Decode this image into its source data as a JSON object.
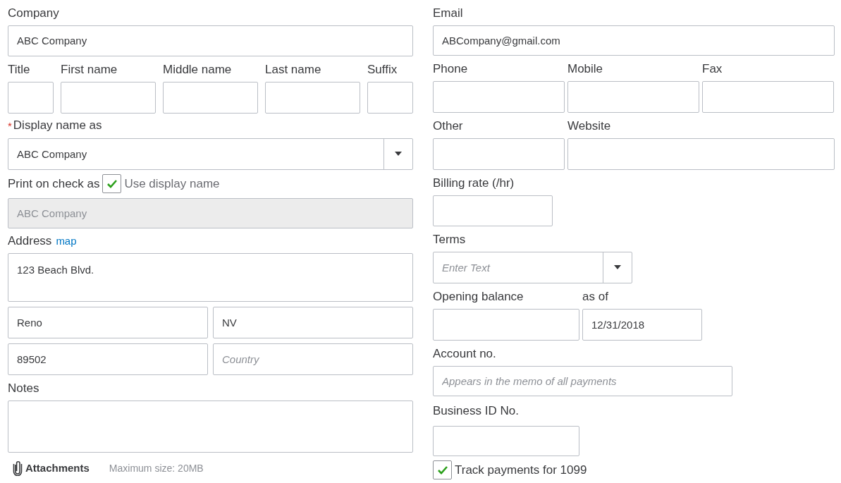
{
  "left": {
    "company": {
      "label": "Company",
      "value": "ABC Company"
    },
    "name_fields": [
      {
        "label": "Title"
      },
      {
        "label": "First name"
      },
      {
        "label": "Middle name"
      },
      {
        "label": "Last name"
      },
      {
        "label": "Suffix"
      }
    ],
    "display_name": {
      "label": "Display name as",
      "required_mark": "*",
      "value": "ABC Company"
    },
    "print_on_check": {
      "label": "Print on check as",
      "checkbox_label": "Use display name",
      "checked": true,
      "value": "ABC Company",
      "disabled": true
    },
    "address": {
      "label": "Address",
      "link": "map",
      "street": "123 Beach Blvd.",
      "city": "Reno",
      "state": "NV",
      "zip": "89502",
      "country_placeholder": "Country"
    },
    "notes": {
      "label": "Notes"
    },
    "attachments": {
      "label": "Attachments",
      "note": "Maximum size: 20MB"
    }
  },
  "right": {
    "email": {
      "label": "Email",
      "value": "ABCompany@gmail.com"
    },
    "phone_fields": [
      {
        "label": "Phone"
      },
      {
        "label": "Mobile"
      },
      {
        "label": "Fax"
      }
    ],
    "other_fields": [
      {
        "label": "Other"
      },
      {
        "label": "Website"
      }
    ],
    "billing_rate": {
      "label": "Billing rate (/hr)"
    },
    "terms": {
      "label": "Terms",
      "placeholder": "Enter Text"
    },
    "opening_balance": {
      "label": "Opening balance"
    },
    "as_of": {
      "label": "as of",
      "value": "12/31/2018"
    },
    "account_no": {
      "label": "Account no.",
      "placeholder": "Appears in the memo of all payments"
    },
    "business_id": {
      "label": "Business ID No."
    },
    "track_1099": {
      "label": "Track payments for 1099",
      "checked": true
    }
  }
}
